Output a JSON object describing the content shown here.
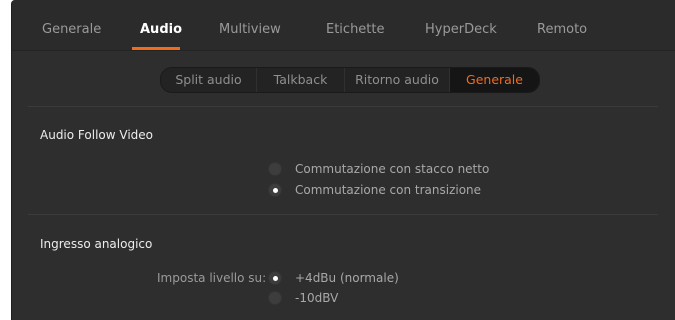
{
  "top_tabs": [
    "Generale",
    "Audio",
    "Multiview",
    "Etichette",
    "HyperDeck",
    "Remoto"
  ],
  "active_top_tab": "Audio",
  "sub_tabs": [
    "Split audio",
    "Talkback",
    "Ritorno audio",
    "Generale"
  ],
  "active_sub_tab": "Generale",
  "audio_follow_video": {
    "title": "Audio Follow Video",
    "options": [
      "Commutazione con stacco netto",
      "Commutazione con transizione"
    ],
    "selected": "Commutazione con transizione"
  },
  "analog_input": {
    "title": "Ingresso analogico",
    "level_label": "Imposta livello su:",
    "options": [
      "+4dBu (normale)",
      "-10dBV"
    ],
    "selected": "+4dBu (normale)"
  },
  "colors": {
    "accent": "#f26b1d",
    "panel_bg": "#2e2e2e"
  }
}
